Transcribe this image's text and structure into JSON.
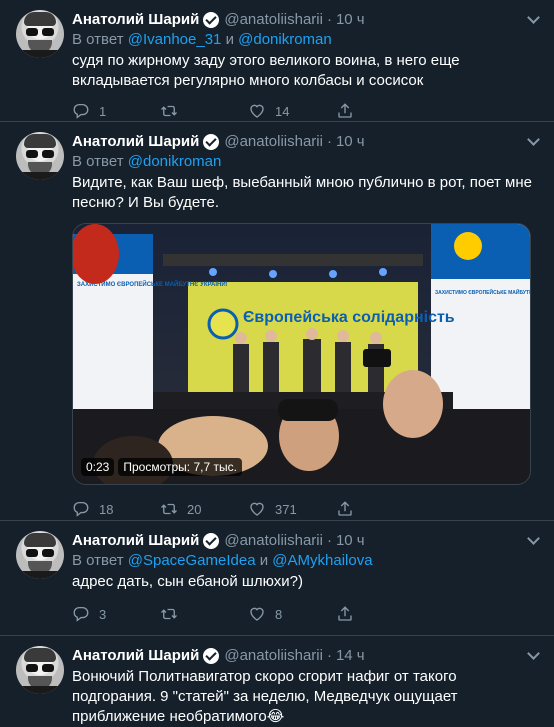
{
  "tweets": [
    {
      "name": "Анатолий Шарий",
      "handle": "@anatoliisharii",
      "time": "10 ч",
      "reply_prefix": "В ответ",
      "mentions": [
        "@Ivanhoe_31",
        "@donikroman"
      ],
      "reply_joiner": "и",
      "text": "судя по жирному заду этого великого воина, в него еще вкладывается регулярно много колбасы и сосисок",
      "replies": "1",
      "retweets": "",
      "likes": "14"
    },
    {
      "name": "Анатолий Шарий",
      "handle": "@anatoliisharii",
      "time": "10 ч",
      "reply_prefix": "В ответ",
      "mentions": [
        "@donikroman"
      ],
      "text": "Видите, как Ваш шеф, выебанный мною публично в рот, поет мне песню? И Вы будете.",
      "video": {
        "duration": "0:23",
        "views": "Просмотры: 7,7 тыс.",
        "banner_title": "Європейська солідарність",
        "banner_left": "ЗАХИСТИМО ЄВРОПЕЙСЬКЕ МАЙБУТНЄ УКРАЇНИ!",
        "banner_right": "ЗАХИСТИМО ЄВРОПЕЙСЬКЕ МАЙБУТНЄ УКРАЇНИ!"
      },
      "replies": "18",
      "retweets": "20",
      "likes": "371"
    },
    {
      "name": "Анатолий Шарий",
      "handle": "@anatoliisharii",
      "time": "10 ч",
      "reply_prefix": "В ответ",
      "mentions": [
        "@SpaceGameIdea",
        "@AMykhailova"
      ],
      "reply_joiner": "и",
      "text": "адрес дать, сын ебаной шлюхи?)",
      "replies": "3",
      "retweets": "",
      "likes": "8"
    },
    {
      "name": "Анатолий Шарий",
      "handle": "@anatoliisharii",
      "time": "14 ч",
      "text": "Вонючий Политнавигатор скоро сгорит нафиг от такого подгорания. 9 \"статей\" за неделю, Медведчук ощущает приближение необратимого😂",
      "emoji_line": "🤟"
    }
  ],
  "colors": {
    "background": "#15202b",
    "border": "#38444d",
    "secondary_text": "#8899a6",
    "link": "#1da1f2"
  },
  "icons": [
    "reply-icon",
    "retweet-icon",
    "like-icon",
    "share-icon",
    "verified-badge-icon",
    "chevron-down-icon"
  ]
}
